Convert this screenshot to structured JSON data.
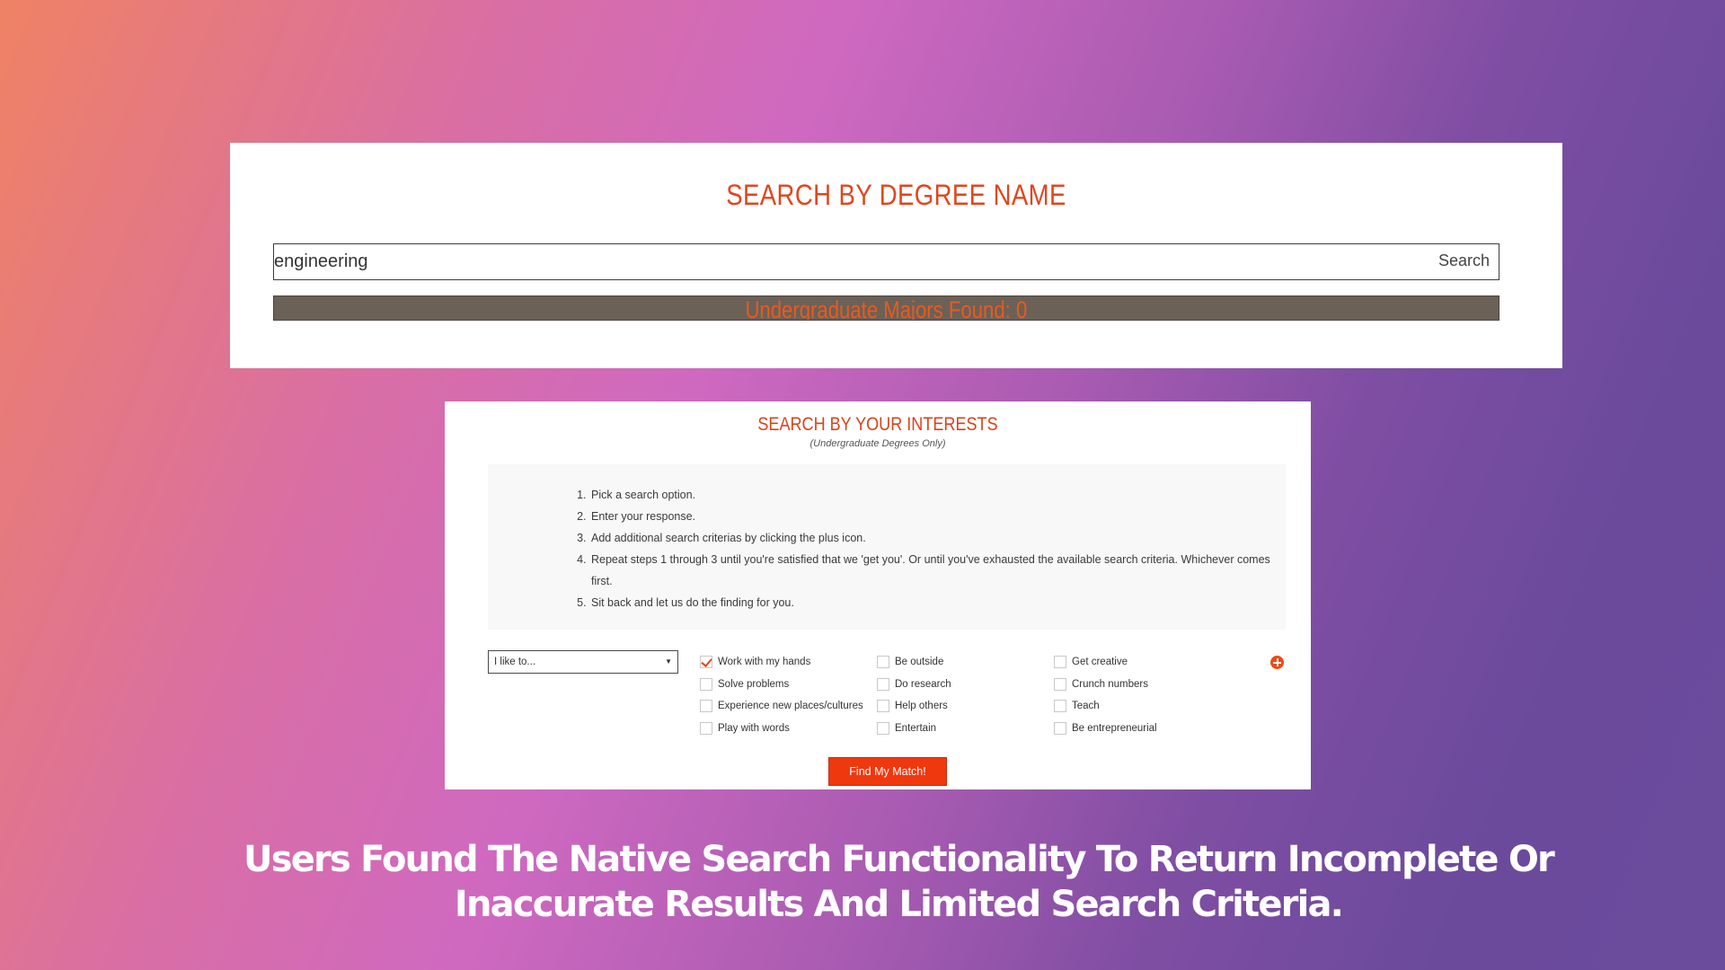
{
  "degree_search": {
    "title": "SEARCH BY DEGREE NAME",
    "input_value": "engineering",
    "search_button": "Search",
    "results_text": "Undergraduate Majors Found: 0"
  },
  "interest_search": {
    "title": "SEARCH BY YOUR INTERESTS",
    "subtitle": "(Undergraduate Degrees Only)",
    "instructions": [
      "Pick a search option.",
      "Enter your response.",
      "Add additional search criterias by clicking the plus icon.",
      "Repeat steps 1 through 3 until you're satisfied that we 'get you'. Or until you've exhausted the available search criteria. Whichever comes first.",
      "Sit back and let us do the finding for you."
    ],
    "select_value": "I like to...",
    "options": [
      {
        "label": "Work with my hands",
        "checked": true
      },
      {
        "label": "Be outside",
        "checked": false
      },
      {
        "label": "Get creative",
        "checked": false
      },
      {
        "label": "Solve problems",
        "checked": false
      },
      {
        "label": "Do research",
        "checked": false
      },
      {
        "label": "Crunch numbers",
        "checked": false
      },
      {
        "label": "Experience new places/cultures",
        "checked": false
      },
      {
        "label": "Help others",
        "checked": false
      },
      {
        "label": "Teach",
        "checked": false
      },
      {
        "label": "Play with words",
        "checked": false
      },
      {
        "label": "Entertain",
        "checked": false
      },
      {
        "label": "Be entrepreneurial",
        "checked": false
      }
    ],
    "add_icon": "plus-circle-icon",
    "match_button": "Find My Match!"
  },
  "caption": "Users Found The Native Search Functionality To Return Incomplete Or Inaccurate Results And Limited Search Criteria.",
  "colors": {
    "accent": "#e0461c",
    "button": "#f0380f",
    "results_bar": "#6b6157"
  }
}
